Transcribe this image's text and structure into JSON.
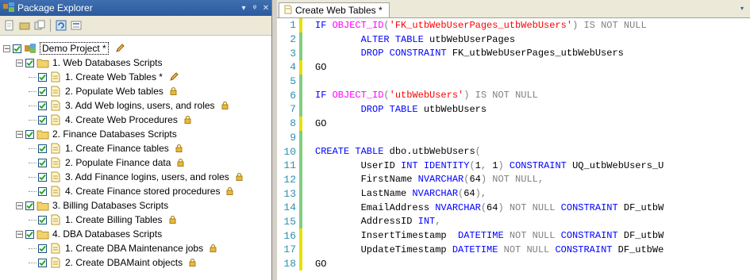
{
  "package_explorer": {
    "title": "Package Explorer",
    "controls": [
      "▾",
      "ᵠ",
      "✕"
    ],
    "toolbar_icons": [
      "new-script-icon",
      "new-folder-icon",
      "move-icon",
      "refresh-icon",
      "properties-icon"
    ],
    "tree": [
      {
        "level": 0,
        "type": "project",
        "label": "Demo Project *",
        "checked": true,
        "expander": "−",
        "tag": "pencil",
        "selected": true
      },
      {
        "level": 1,
        "type": "folder",
        "label": "1. Web Databases Scripts",
        "checked": true,
        "expander": "−"
      },
      {
        "level": 2,
        "type": "script",
        "label": "1. Create Web Tables *",
        "checked": true,
        "tag": "pencil"
      },
      {
        "level": 2,
        "type": "script",
        "label": "2. Populate Web tables",
        "checked": true,
        "tag": "lock"
      },
      {
        "level": 2,
        "type": "script",
        "label": "3. Add Web logins, users, and roles",
        "checked": true,
        "tag": "lock"
      },
      {
        "level": 2,
        "type": "script",
        "label": "4. Create Web Procedures",
        "checked": true,
        "tag": "lock"
      },
      {
        "level": 1,
        "type": "folder",
        "label": "2. Finance Databases Scripts",
        "checked": true,
        "expander": "−"
      },
      {
        "level": 2,
        "type": "script",
        "label": "1. Create Finance tables",
        "checked": true,
        "tag": "lock"
      },
      {
        "level": 2,
        "type": "script",
        "label": "2. Populate Finance data",
        "checked": true,
        "tag": "lock"
      },
      {
        "level": 2,
        "type": "script",
        "label": "3. Add Finance logins, users, and roles",
        "checked": true,
        "tag": "lock"
      },
      {
        "level": 2,
        "type": "script",
        "label": "4. Create Finance stored procedures",
        "checked": true,
        "tag": "lock"
      },
      {
        "level": 1,
        "type": "folder",
        "label": "3. Billing Databases Scripts",
        "checked": true,
        "expander": "−"
      },
      {
        "level": 2,
        "type": "script",
        "label": "1. Create Billing Tables",
        "checked": true,
        "tag": "lock"
      },
      {
        "level": 1,
        "type": "folder",
        "label": "4. DBA Databases Scripts",
        "checked": true,
        "expander": "−"
      },
      {
        "level": 2,
        "type": "script",
        "label": "1. Create DBA Maintenance jobs",
        "checked": true,
        "tag": "lock"
      },
      {
        "level": 2,
        "type": "script",
        "label": "2. Create DBAMaint objects",
        "checked": true,
        "tag": "lock"
      }
    ]
  },
  "editor": {
    "tab_label": "Create Web Tables *",
    "tab_arrow": "▾",
    "lines": [
      {
        "n": "1",
        "mark": "yellow",
        "tokens": [
          [
            "kw",
            "IF "
          ],
          [
            "fn",
            "OBJECT_ID"
          ],
          [
            "gray",
            "("
          ],
          [
            "str",
            "'FK_utbWebUserPages_utbWebUsers'"
          ],
          [
            "gray",
            ") "
          ],
          [
            "gray",
            "IS NOT NULL"
          ]
        ]
      },
      {
        "n": "2",
        "mark": "green",
        "tokens": [
          [
            "txt",
            "        "
          ],
          [
            "kw",
            "ALTER TABLE "
          ],
          [
            "txt",
            "utbWebUserPages"
          ]
        ]
      },
      {
        "n": "3",
        "mark": "green",
        "tokens": [
          [
            "txt",
            "        "
          ],
          [
            "kw",
            "DROP CONSTRAINT "
          ],
          [
            "txt",
            "FK_utbWebUserPages_utbWebUsers"
          ]
        ]
      },
      {
        "n": "4",
        "mark": "yellow",
        "tokens": [
          [
            "txt",
            "GO"
          ]
        ]
      },
      {
        "n": "5",
        "mark": "green",
        "tokens": []
      },
      {
        "n": "6",
        "mark": "green",
        "tokens": [
          [
            "kw",
            "IF "
          ],
          [
            "fn",
            "OBJECT_ID"
          ],
          [
            "gray",
            "("
          ],
          [
            "str",
            "'utbWebUsers'"
          ],
          [
            "gray",
            ") "
          ],
          [
            "gray",
            "IS NOT NULL"
          ]
        ]
      },
      {
        "n": "7",
        "mark": "green",
        "tokens": [
          [
            "txt",
            "        "
          ],
          [
            "kw",
            "DROP TABLE "
          ],
          [
            "txt",
            "utbWebUsers"
          ]
        ]
      },
      {
        "n": "8",
        "mark": "yellow",
        "tokens": [
          [
            "txt",
            "GO"
          ]
        ]
      },
      {
        "n": "9",
        "mark": "green",
        "tokens": []
      },
      {
        "n": "10",
        "mark": "green",
        "tokens": [
          [
            "kw",
            "CREATE TABLE "
          ],
          [
            "txt",
            "dbo.utbWebUsers"
          ],
          [
            "gray",
            "("
          ]
        ]
      },
      {
        "n": "11",
        "mark": "green",
        "tokens": [
          [
            "txt",
            "        UserID "
          ],
          [
            "kw",
            "INT IDENTITY"
          ],
          [
            "gray",
            "("
          ],
          [
            "txt",
            "1"
          ],
          [
            "gray",
            ", "
          ],
          [
            "txt",
            "1"
          ],
          [
            "gray",
            ") "
          ],
          [
            "kw",
            "CONSTRAINT "
          ],
          [
            "txt",
            "UQ_utbWebUsers_U"
          ]
        ]
      },
      {
        "n": "12",
        "mark": "green",
        "tokens": [
          [
            "txt",
            "        FirstName "
          ],
          [
            "kw",
            "NVARCHAR"
          ],
          [
            "gray",
            "("
          ],
          [
            "txt",
            "64"
          ],
          [
            "gray",
            ") NOT NULL,"
          ]
        ]
      },
      {
        "n": "13",
        "mark": "green",
        "tokens": [
          [
            "txt",
            "        LastName "
          ],
          [
            "kw",
            "NVARCHAR"
          ],
          [
            "gray",
            "("
          ],
          [
            "txt",
            "64"
          ],
          [
            "gray",
            "),"
          ]
        ]
      },
      {
        "n": "14",
        "mark": "green",
        "tokens": [
          [
            "txt",
            "        EmailAddress "
          ],
          [
            "kw",
            "NVARCHAR"
          ],
          [
            "gray",
            "("
          ],
          [
            "txt",
            "64"
          ],
          [
            "gray",
            ") NOT NULL "
          ],
          [
            "kw",
            "CONSTRAINT "
          ],
          [
            "txt",
            "DF_utbW"
          ]
        ]
      },
      {
        "n": "15",
        "mark": "green",
        "tokens": [
          [
            "txt",
            "        AddressID "
          ],
          [
            "kw",
            "INT"
          ],
          [
            "gray",
            ","
          ]
        ]
      },
      {
        "n": "16",
        "mark": "yellow",
        "tokens": [
          [
            "txt",
            "        InsertTimestamp  "
          ],
          [
            "kw",
            "DATETIME "
          ],
          [
            "gray",
            "NOT NULL "
          ],
          [
            "kw",
            "CONSTRAINT "
          ],
          [
            "txt",
            "DF_utbW"
          ]
        ]
      },
      {
        "n": "17",
        "mark": "yellow",
        "tokens": [
          [
            "txt",
            "        UpdateTimestamp "
          ],
          [
            "kw",
            "DATETIME "
          ],
          [
            "gray",
            "NOT NULL "
          ],
          [
            "kw",
            "CONSTRAINT "
          ],
          [
            "txt",
            "DF_utbWe"
          ]
        ]
      },
      {
        "n": "18",
        "mark": "yellow",
        "tokens": [
          [
            "txt",
            "GO"
          ]
        ]
      }
    ]
  }
}
